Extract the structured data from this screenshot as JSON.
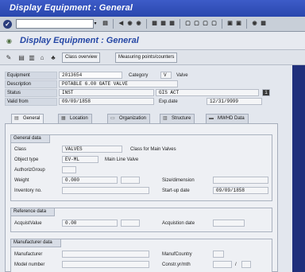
{
  "window": {
    "title": "Display Equipment : General"
  },
  "command": {
    "enter_icon": "✓",
    "field_value": "",
    "dropdown_icon": "▾",
    "toolbar_icons": [
      {
        "name": "save-icon",
        "glyph": "▤"
      },
      {
        "name": "back-icon",
        "glyph": "◀"
      },
      {
        "name": "exit-icon",
        "glyph": "◉"
      },
      {
        "name": "cancel-icon",
        "glyph": "◉"
      },
      {
        "name": "print-icon",
        "glyph": "▦"
      },
      {
        "name": "find-icon",
        "glyph": "▦"
      },
      {
        "name": "find-next-icon",
        "glyph": "▦"
      },
      {
        "name": "first-page-icon",
        "glyph": "▢"
      },
      {
        "name": "prev-page-icon",
        "glyph": "▢"
      },
      {
        "name": "next-page-icon",
        "glyph": "▢"
      },
      {
        "name": "last-page-icon",
        "glyph": "▢"
      },
      {
        "name": "new-session-icon",
        "glyph": "▣"
      },
      {
        "name": "shortcut-icon",
        "glyph": "▣"
      },
      {
        "name": "help-icon",
        "glyph": "◉"
      },
      {
        "name": "layout-icon",
        "glyph": "▦"
      }
    ]
  },
  "header": {
    "title": "Display Equipment : General"
  },
  "app_toolbar": {
    "icons": [
      "✎",
      "▤",
      "▥",
      "⌂",
      "♣"
    ],
    "buttons": [
      "Class overview",
      "Measuring points/counters"
    ]
  },
  "equipment": {
    "equipment_label": "Equipment",
    "equipment_value": "2013654",
    "category_label": "Category",
    "category_value": "V",
    "category_text": "Valve",
    "description_label": "Description",
    "description_value": "POTABLE 6.00 GATE VALVE",
    "status_label": "Status",
    "status_value": "INST",
    "status_value2": "GIS ACT",
    "status_info_icon": "i",
    "valid_from_label": "Valid from",
    "valid_from_value": "09/09/1858",
    "exp_date_label": "Exp.date",
    "exp_date_value": "12/31/9999"
  },
  "tabs": [
    {
      "label": "General",
      "icon": "▤"
    },
    {
      "label": "Location",
      "icon": "▦"
    },
    {
      "label": "Organization",
      "icon": "▭"
    },
    {
      "label": "Structure",
      "icon": "▥"
    },
    {
      "label": "MWHD Data",
      "icon": "▬"
    }
  ],
  "general_data": {
    "title": "General data",
    "class_label": "Class",
    "class_value": "VALVES",
    "class_text": "Class for Main Valves",
    "object_type_label": "Object type",
    "object_type_value": "EV-ML",
    "object_type_text": "Main Line Valve",
    "auth_group_label": "AuthorizGroup",
    "weight_label": "Weight",
    "weight_value": "0.000",
    "size_label": "Size/dimension",
    "inventory_label": "Inventory no.",
    "startup_label": "Start-up date",
    "startup_value": "09/09/1858"
  },
  "reference_data": {
    "title": "Reference data",
    "acquis_value_label": "AcquistValue",
    "acquis_value": "0.00",
    "acquis_date_label": "Acquistion date"
  },
  "manufacturer_data": {
    "title": "Manufacturer data",
    "manufacturer_label": "Manufacturer",
    "manuf_country_label": "ManufCountry",
    "model_label": "Model number",
    "constr_label": "Constr.yr/mth",
    "constr_sep": "/"
  }
}
